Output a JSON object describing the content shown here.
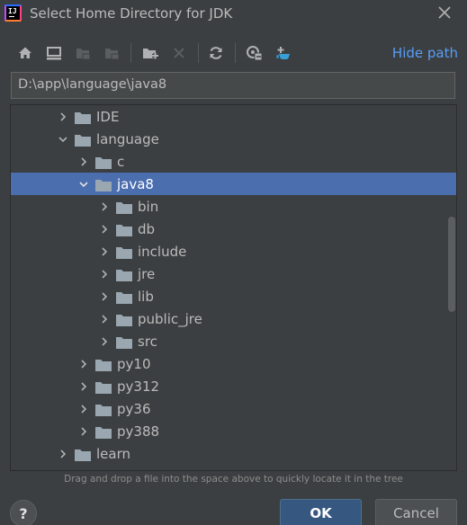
{
  "window": {
    "title": "Select Home Directory for JDK"
  },
  "toolbar": {
    "icons": [
      "home-icon",
      "desktop-icon",
      "project-icon",
      "module-icon",
      "new-folder-icon",
      "delete-icon",
      "refresh-icon",
      "show-hidden-icon",
      "download-jdk-icon"
    ],
    "hide_path_label": "Hide path"
  },
  "path": {
    "value": "D:\\app\\language\\java8"
  },
  "tree": {
    "rows": [
      {
        "label": "IDE",
        "expanded": false,
        "selected": false
      },
      {
        "label": "language",
        "expanded": true,
        "selected": false
      },
      {
        "label": "c",
        "expanded": false,
        "selected": false
      },
      {
        "label": "java8",
        "expanded": true,
        "selected": true
      },
      {
        "label": "bin",
        "expanded": false,
        "selected": false
      },
      {
        "label": "db",
        "expanded": false,
        "selected": false
      },
      {
        "label": "include",
        "expanded": false,
        "selected": false
      },
      {
        "label": "jre",
        "expanded": false,
        "selected": false
      },
      {
        "label": "lib",
        "expanded": false,
        "selected": false
      },
      {
        "label": "public_jre",
        "expanded": false,
        "selected": false
      },
      {
        "label": "src",
        "expanded": false,
        "selected": false
      },
      {
        "label": "py10",
        "expanded": false,
        "selected": false
      },
      {
        "label": "py312",
        "expanded": false,
        "selected": false
      },
      {
        "label": "py36",
        "expanded": false,
        "selected": false
      },
      {
        "label": "py388",
        "expanded": false,
        "selected": false
      },
      {
        "label": "learn",
        "expanded": false,
        "selected": false
      }
    ]
  },
  "hint": "Drag and drop a file into the space above to quickly locate it in the tree",
  "buttons": {
    "help": "?",
    "ok": "OK",
    "cancel": "Cancel"
  },
  "colors": {
    "accent": "#589df6",
    "selection": "#4b6eaf",
    "folder": "#9aa7b0",
    "ok_button": "#365880"
  }
}
